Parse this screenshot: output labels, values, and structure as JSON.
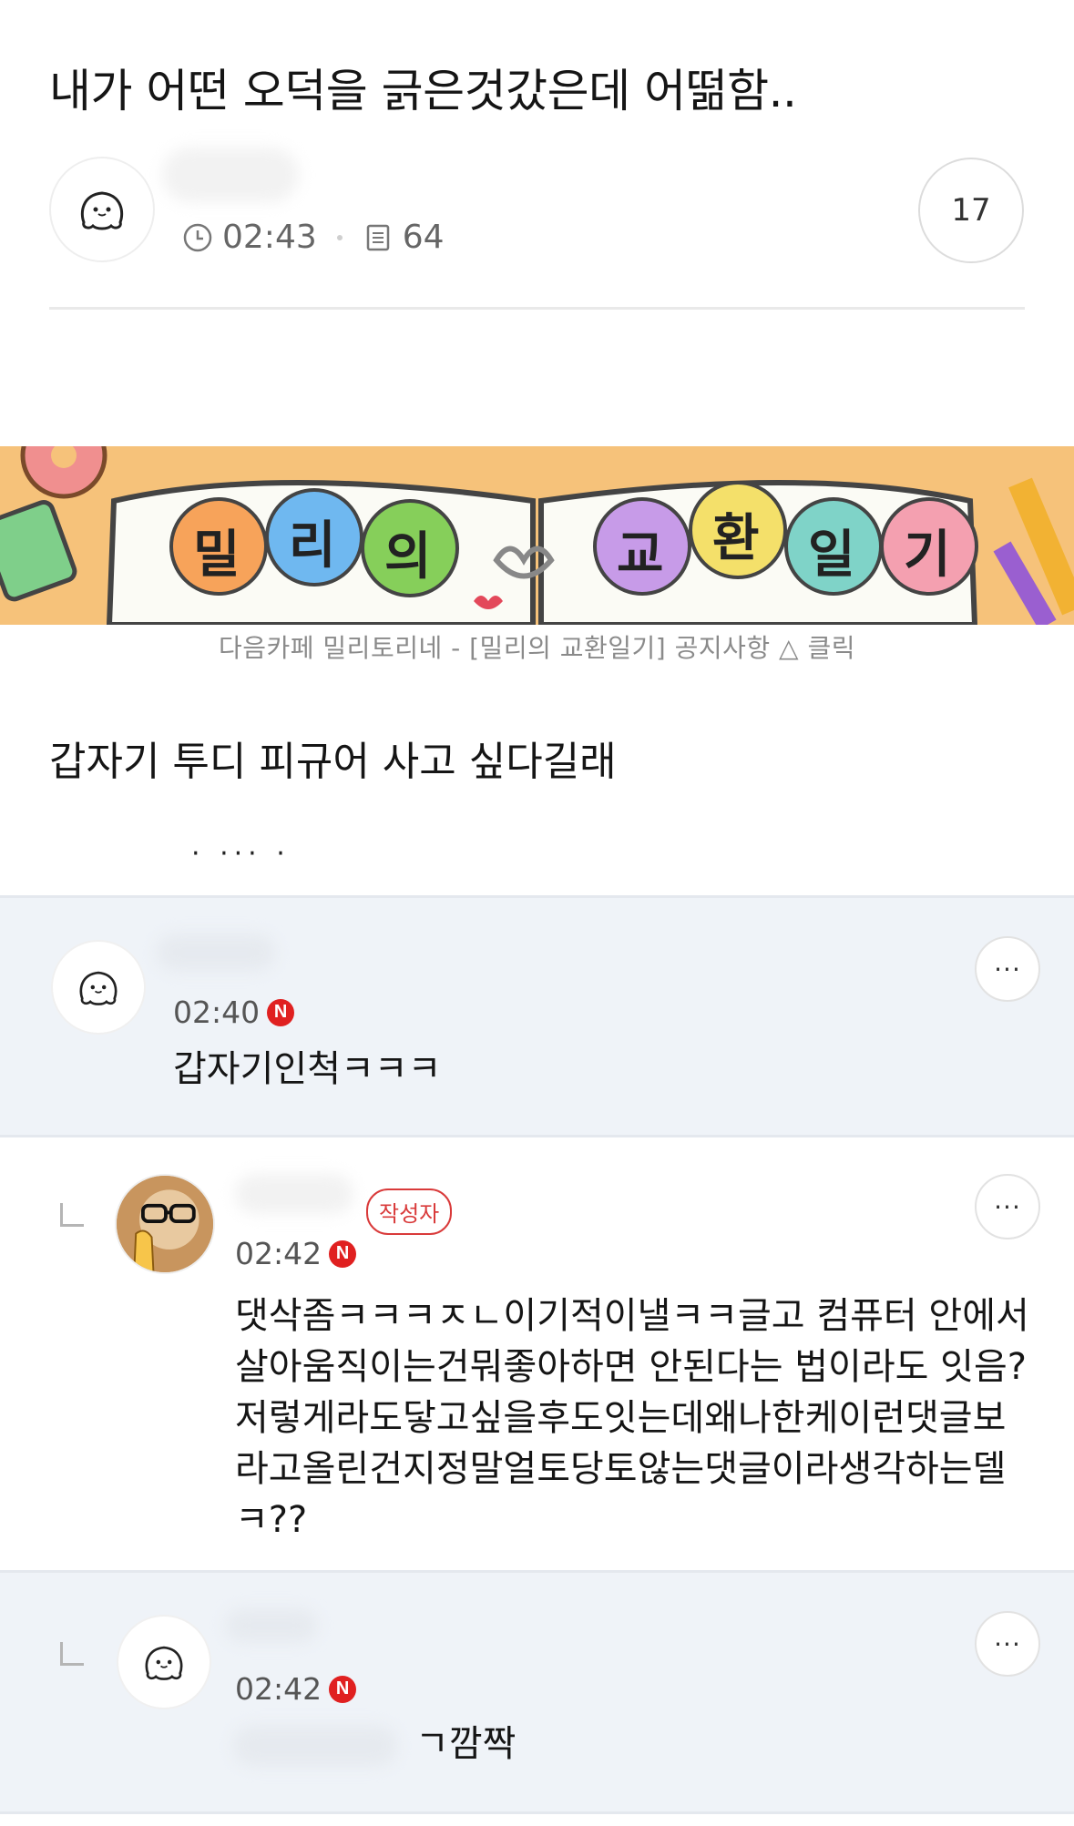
{
  "post": {
    "title": "내가 어떤 오덕을 긁은것갔은데 어떪함..",
    "time": "02:43",
    "views": "64",
    "comment_count": "17",
    "body_line1": "갑자기 투디 피규어 사고 싶다길래",
    "body_cut": "· ··· ·"
  },
  "banner": {
    "title_chars": [
      "밀",
      "리",
      "의",
      "교",
      "환",
      "일",
      "기"
    ],
    "caption": "다음카페 밀리토리네 - [밀리의 교환일기] 공지사항 △ 클릭"
  },
  "comments": [
    {
      "time": "02:40",
      "badge": "N",
      "text": "갑자기인척ㅋㅋㅋ",
      "more": "···"
    },
    {
      "time": "02:42",
      "badge": "N",
      "author_badge": "작성자",
      "lines": [
        "댓삭좀ㅋㅋㅋㅈㄴ이기적이낼ㅋㅋ글고 컴퓨터 안에서",
        "살아움직이는건뭐좋아하면 안된다는 법이라도 잇음?",
        "저렇게라도닿고싶을후도잇는데왜나한케이런댓글보",
        "라고올린건지정말얼토당토않는댓글이라생각하는델",
        "ㅋ??"
      ],
      "more": "···"
    },
    {
      "time": "02:42",
      "badge": "N",
      "text": "ㄱ깜짝",
      "more": "···"
    }
  ],
  "colors": {
    "accent_red": "#e02020",
    "comment_bg": "#eff3f8",
    "banner_bg": "#f6c27a"
  }
}
